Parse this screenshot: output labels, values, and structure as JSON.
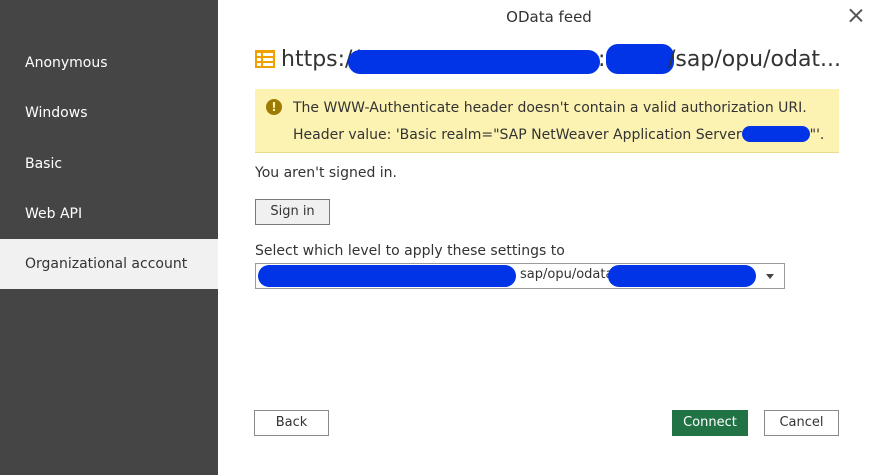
{
  "dialog": {
    "title": "OData feed"
  },
  "sidebar": {
    "items": [
      {
        "label": "Anonymous"
      },
      {
        "label": "Windows"
      },
      {
        "label": "Basic"
      },
      {
        "label": "Web API"
      },
      {
        "label": "Organizational account"
      }
    ]
  },
  "url": {
    "prefix": "https://",
    "colon": ":",
    "suffix": "/sap/opu/odat..."
  },
  "warning": {
    "line1": "The WWW-Authenticate header doesn't contain a valid authorization URI.",
    "line2_prefix": "Header value: 'Basic realm=\"SAP NetWeaver Application Server",
    "line2_suffix": "\"'."
  },
  "status": {
    "text": "You aren't signed in."
  },
  "buttons": {
    "sign_in": "Sign in",
    "back": "Back",
    "connect": "Connect",
    "cancel": "Cancel"
  },
  "level": {
    "label": "Select which level to apply these settings to",
    "value_visible": "sap/opu/odata"
  },
  "colors": {
    "accent": "#217346",
    "sidebar": "#454545",
    "warning_bg": "#fcf3b3",
    "redaction": "#0034e6"
  }
}
